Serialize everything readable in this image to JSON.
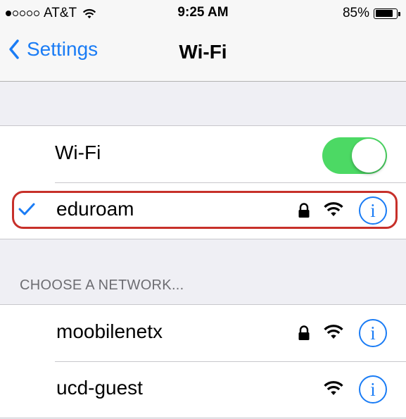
{
  "status_bar": {
    "carrier": "AT&T",
    "signal_bars_filled": 1,
    "signal_bars_total": 5,
    "time": "9:25 AM",
    "battery_percent": "85%",
    "battery_level": 0.85
  },
  "nav": {
    "back_label": "Settings",
    "title": "Wi-Fi"
  },
  "wifi_toggle": {
    "label": "Wi-Fi",
    "on": true
  },
  "connected_network": {
    "name": "eduroam",
    "secured": true,
    "selected": true
  },
  "section_header": "CHOOSE A NETWORK...",
  "networks": [
    {
      "name": "moobilenetx",
      "secured": true
    },
    {
      "name": "ucd-guest",
      "secured": false
    }
  ],
  "colors": {
    "accent": "#1a7cf5",
    "toggle_on": "#4cd964",
    "highlight": "#c7302a"
  },
  "icons": [
    "wifi-signal-icon",
    "chevron-left-icon",
    "checkmark-icon",
    "lock-icon",
    "info-icon"
  ]
}
